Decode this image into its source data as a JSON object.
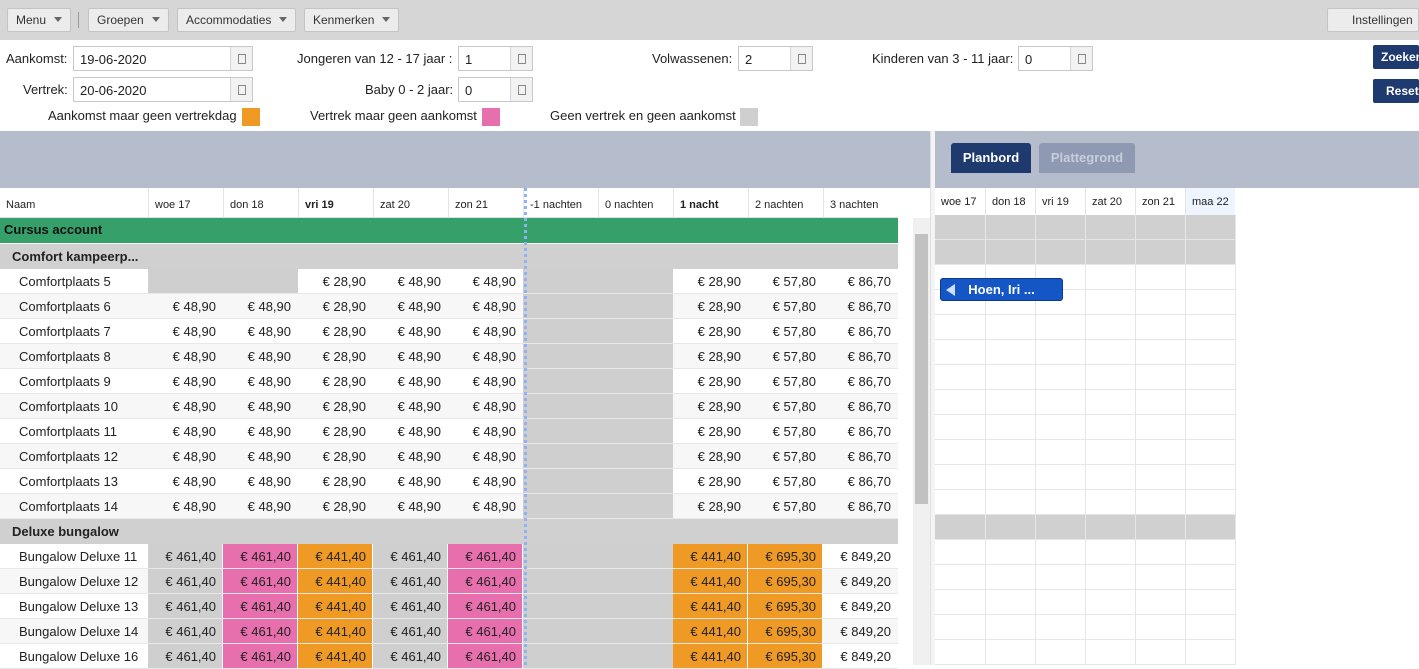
{
  "toolbar": {
    "menu": "Menu",
    "groepen": "Groepen",
    "accommodaties": "Accommodaties",
    "kenmerken": "Kenmerken",
    "instellingen": "Instellingen"
  },
  "form": {
    "aankomst_label": "Aankomst:",
    "aankomst_value": "19-06-2020",
    "vertrek_label": "Vertrek:",
    "vertrek_value": "20-06-2020",
    "jongeren_label": "Jongeren van 12 - 17 jaar :",
    "jongeren_value": "1",
    "baby_label": "Baby 0 - 2 jaar:",
    "baby_value": "0",
    "volwassenen_label": "Volwassenen:",
    "volwassenen_value": "2",
    "kinderen_label": "Kinderen van 3 - 11 jaar:",
    "kinderen_value": "0",
    "zoeken": "Zoeken",
    "reset": "Reset"
  },
  "legend": {
    "aankomst": "Aankomst maar geen vertrekdag",
    "aankomst_color": "#ef9a25",
    "vertrek": "Vertrek maar geen aankomst",
    "vertrek_color": "#e86fad",
    "geen": "Geen vertrek en geen aankomst",
    "geen_color": "#cfcfcf"
  },
  "grid": {
    "columns": [
      "Naam",
      "woe 17",
      "don 18",
      "vri 19",
      "zat 20",
      "zon 21",
      "-1 nachten",
      "0 nachten",
      "1 nacht",
      "2 nachten",
      "3 nachten"
    ],
    "group": "Cursus account",
    "categories": [
      "Comfort kampeerp...",
      "Deluxe bungalow"
    ],
    "comfort_rows": [
      {
        "name": "Comfortplaats 5",
        "cells": [
          "",
          "",
          "€ 28,90",
          "€ 48,90",
          "€ 48,90",
          "",
          "",
          "€ 28,90",
          "€ 57,80",
          "€ 86,70"
        ]
      },
      {
        "name": "Comfortplaats 6",
        "cells": [
          "€ 48,90",
          "€ 48,90",
          "€ 28,90",
          "€ 48,90",
          "€ 48,90",
          "",
          "",
          "€ 28,90",
          "€ 57,80",
          "€ 86,70"
        ]
      },
      {
        "name": "Comfortplaats 7",
        "cells": [
          "€ 48,90",
          "€ 48,90",
          "€ 28,90",
          "€ 48,90",
          "€ 48,90",
          "",
          "",
          "€ 28,90",
          "€ 57,80",
          "€ 86,70"
        ]
      },
      {
        "name": "Comfortplaats 8",
        "cells": [
          "€ 48,90",
          "€ 48,90",
          "€ 28,90",
          "€ 48,90",
          "€ 48,90",
          "",
          "",
          "€ 28,90",
          "€ 57,80",
          "€ 86,70"
        ]
      },
      {
        "name": "Comfortplaats 9",
        "cells": [
          "€ 48,90",
          "€ 48,90",
          "€ 28,90",
          "€ 48,90",
          "€ 48,90",
          "",
          "",
          "€ 28,90",
          "€ 57,80",
          "€ 86,70"
        ]
      },
      {
        "name": "Comfortplaats 10",
        "cells": [
          "€ 48,90",
          "€ 48,90",
          "€ 28,90",
          "€ 48,90",
          "€ 48,90",
          "",
          "",
          "€ 28,90",
          "€ 57,80",
          "€ 86,70"
        ]
      },
      {
        "name": "Comfortplaats 11",
        "cells": [
          "€ 48,90",
          "€ 48,90",
          "€ 28,90",
          "€ 48,90",
          "€ 48,90",
          "",
          "",
          "€ 28,90",
          "€ 57,80",
          "€ 86,70"
        ]
      },
      {
        "name": "Comfortplaats 12",
        "cells": [
          "€ 48,90",
          "€ 48,90",
          "€ 28,90",
          "€ 48,90",
          "€ 48,90",
          "",
          "",
          "€ 28,90",
          "€ 57,80",
          "€ 86,70"
        ]
      },
      {
        "name": "Comfortplaats 13",
        "cells": [
          "€ 48,90",
          "€ 48,90",
          "€ 28,90",
          "€ 48,90",
          "€ 48,90",
          "",
          "",
          "€ 28,90",
          "€ 57,80",
          "€ 86,70"
        ]
      },
      {
        "name": "Comfortplaats 14",
        "cells": [
          "€ 48,90",
          "€ 48,90",
          "€ 28,90",
          "€ 48,90",
          "€ 48,90",
          "",
          "",
          "€ 28,90",
          "€ 57,80",
          "€ 86,70"
        ]
      }
    ],
    "deluxe_rows": [
      {
        "name": "Bungalow Deluxe 11",
        "cells": [
          "€ 461,40",
          "€ 461,40",
          "€ 441,40",
          "€ 461,40",
          "€ 461,40",
          "",
          "",
          "€ 441,40",
          "€ 695,30",
          "€ 849,20"
        ]
      },
      {
        "name": "Bungalow Deluxe 12",
        "cells": [
          "€ 461,40",
          "€ 461,40",
          "€ 441,40",
          "€ 461,40",
          "€ 461,40",
          "",
          "",
          "€ 441,40",
          "€ 695,30",
          "€ 849,20"
        ]
      },
      {
        "name": "Bungalow Deluxe 13",
        "cells": [
          "€ 461,40",
          "€ 461,40",
          "€ 441,40",
          "€ 461,40",
          "€ 461,40",
          "",
          "",
          "€ 441,40",
          "€ 695,30",
          "€ 849,20"
        ]
      },
      {
        "name": "Bungalow Deluxe 14",
        "cells": [
          "€ 461,40",
          "€ 461,40",
          "€ 441,40",
          "€ 461,40",
          "€ 461,40",
          "",
          "",
          "€ 441,40",
          "€ 695,30",
          "€ 849,20"
        ]
      },
      {
        "name": "Bungalow Deluxe 16",
        "cells": [
          "€ 461,40",
          "€ 461,40",
          "€ 441,40",
          "€ 461,40",
          "€ 461,40",
          "",
          "",
          "€ 441,40",
          "€ 695,30",
          "€ 849,20"
        ]
      }
    ]
  },
  "planner": {
    "tab_active": "Planbord",
    "tab_inactive": "Plattegrond",
    "days": [
      "woe 17",
      "don 18",
      "vri 19",
      "zat 20",
      "zon 21",
      "maa 22"
    ],
    "booking": "Hoen, Iri ..."
  }
}
